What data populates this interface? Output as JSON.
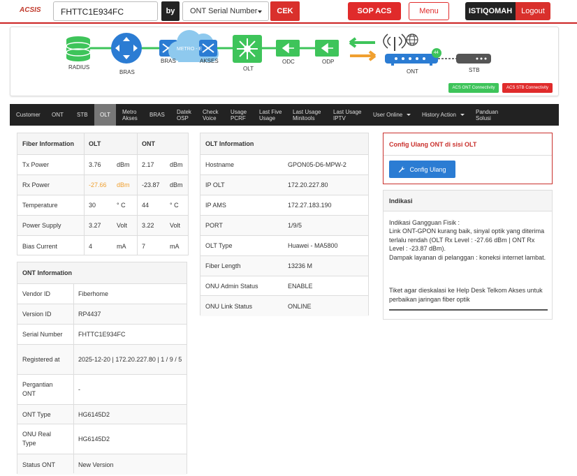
{
  "header": {
    "logo": "ACSIS",
    "search_value": "FHTTC1E934FC",
    "by_label": "by",
    "by_select": "ONT Serial Number",
    "cek_label": "CEK",
    "sop_label": "SOP ACS",
    "menu_label": "Menu",
    "user_label": "ISTIQOMAH",
    "logout_label": "Logout"
  },
  "topology": {
    "radius": "RADIUS",
    "bras1": "BRAS",
    "bras2": "BRAS",
    "metro": "METRO - E",
    "akses": "AKSES",
    "olt": "OLT",
    "odc": "ODC",
    "odp": "ODP",
    "ont": "ONT",
    "stb": "STB",
    "acs_ont": "ACS ONT Connectivity",
    "acs_stb": "ACS STB Connectivity",
    "ont_badge": "44"
  },
  "nav": [
    "Customer",
    "ONT",
    "STB",
    "OLT",
    "Metro Akses",
    "BRAS",
    "Datek OSP",
    "Check Voice",
    "Usage PCRF",
    "Last Five Usage",
    "Last Usage Minitools",
    "Last Usage IPTV",
    "User Online",
    "History Action",
    "Panduan Solusi"
  ],
  "fiber": {
    "headers": [
      "Fiber Information",
      "OLT",
      "ONT"
    ],
    "rows": [
      {
        "label": "Tx Power",
        "olt": "3.76",
        "olt_unit": "dBm",
        "ont": "2.17",
        "ont_unit": "dBm"
      },
      {
        "label": "Rx Power",
        "olt": "-27.66",
        "olt_unit": "dBm",
        "ont": "-23.87",
        "ont_unit": "dBm"
      },
      {
        "label": "Temperature",
        "olt": "30",
        "olt_unit": "° C",
        "ont": "44",
        "ont_unit": "° C"
      },
      {
        "label": "Power Supply",
        "olt": "3.27",
        "olt_unit": "Volt",
        "ont": "3.22",
        "ont_unit": "Volt"
      },
      {
        "label": "Bias Current",
        "olt": "4",
        "olt_unit": "mA",
        "ont": "7",
        "ont_unit": "mA"
      }
    ]
  },
  "ont_info": {
    "title": "ONT Information",
    "rows": [
      {
        "label": "Vendor ID",
        "value": "Fiberhome"
      },
      {
        "label": "Version ID",
        "value": "RP4437"
      },
      {
        "label": "Serial Number",
        "value": "FHTTC1E934FC"
      },
      {
        "label": "Registered at",
        "value": "2025-12-20 | 172.20.227.80 | 1 / 9 / 5"
      },
      {
        "label": "Pergantian ONT",
        "value": "-"
      },
      {
        "label": "ONT Type",
        "value": "HG6145D2"
      },
      {
        "label": "ONU Real Type",
        "value": "HG6145D2"
      },
      {
        "label": "Status ONT",
        "value": "New Version"
      }
    ]
  },
  "olt_info": {
    "title": "OLT Information",
    "rows": [
      {
        "label": "Hostname",
        "value": "GPON05-D6-MPW-2"
      },
      {
        "label": "IP OLT",
        "value": "172.20.227.80"
      },
      {
        "label": "IP AMS",
        "value": "172.27.183.190"
      },
      {
        "label": "PORT",
        "value": "1/9/5"
      },
      {
        "label": "OLT Type",
        "value": "Huawei - MA5800"
      },
      {
        "label": "Fiber Length",
        "value": "13236 M"
      },
      {
        "label": "ONU Admin Status",
        "value": "ENABLE"
      },
      {
        "label": "ONU Link Status",
        "value": "ONLINE"
      }
    ]
  },
  "config": {
    "title": "Config Ulang ONT di sisi OLT",
    "button": "Config Ulang"
  },
  "indikasi": {
    "title": "Indikasi",
    "p1": "Indikasi Gangguan Fisik :",
    "p2": "Link ONT-GPON kurang baik, sinyal optik yang diterima terlalu rendah (OLT Rx Level : -27.66 dBm | ONT Rx Level : -23.87 dBm).",
    "p3": "Dampak layanan di pelanggan : koneksi internet lambat.",
    "p4": "Tiket agar dieskalasi ke Help Desk Telkom Akses untuk perbaikan jaringan fiber optik"
  },
  "colors": {
    "red": "#d9302c",
    "green": "#3ec45a",
    "blue": "#2b7cd3",
    "warn": "#f0a030"
  }
}
